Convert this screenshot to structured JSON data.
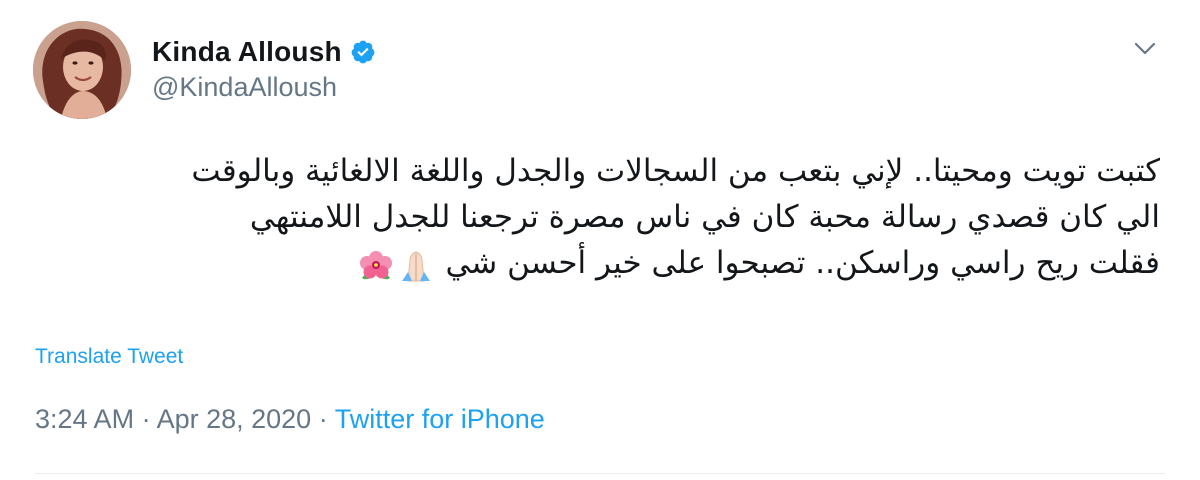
{
  "author": {
    "display_name": "Kinda Alloush",
    "handle": "@KindaAlloush",
    "verified": true
  },
  "tweet": {
    "lines": [
      "كتبت تويت ومحيتا.. لإني بتعب من السجالات والجدل واللغة الالغائية وبالوقت",
      "الي كان قصدي رسالة محبة كان في ناس مصرة ترجعنا للجدل اللامنتهي",
      "فقلت ريح راسي وراسكن.. تصبحوا على خير أحسن شي"
    ],
    "emojis": [
      "folded-hands",
      "hibiscus"
    ]
  },
  "actions": {
    "translate_label": "Translate Tweet"
  },
  "meta": {
    "time": "3:24 AM",
    "separator1": " · ",
    "date": "Apr 28, 2020",
    "separator2": " · ",
    "source": "Twitter for iPhone"
  },
  "colors": {
    "link": "#1da1f2",
    "secondary": "#657786",
    "text": "#14171a"
  }
}
